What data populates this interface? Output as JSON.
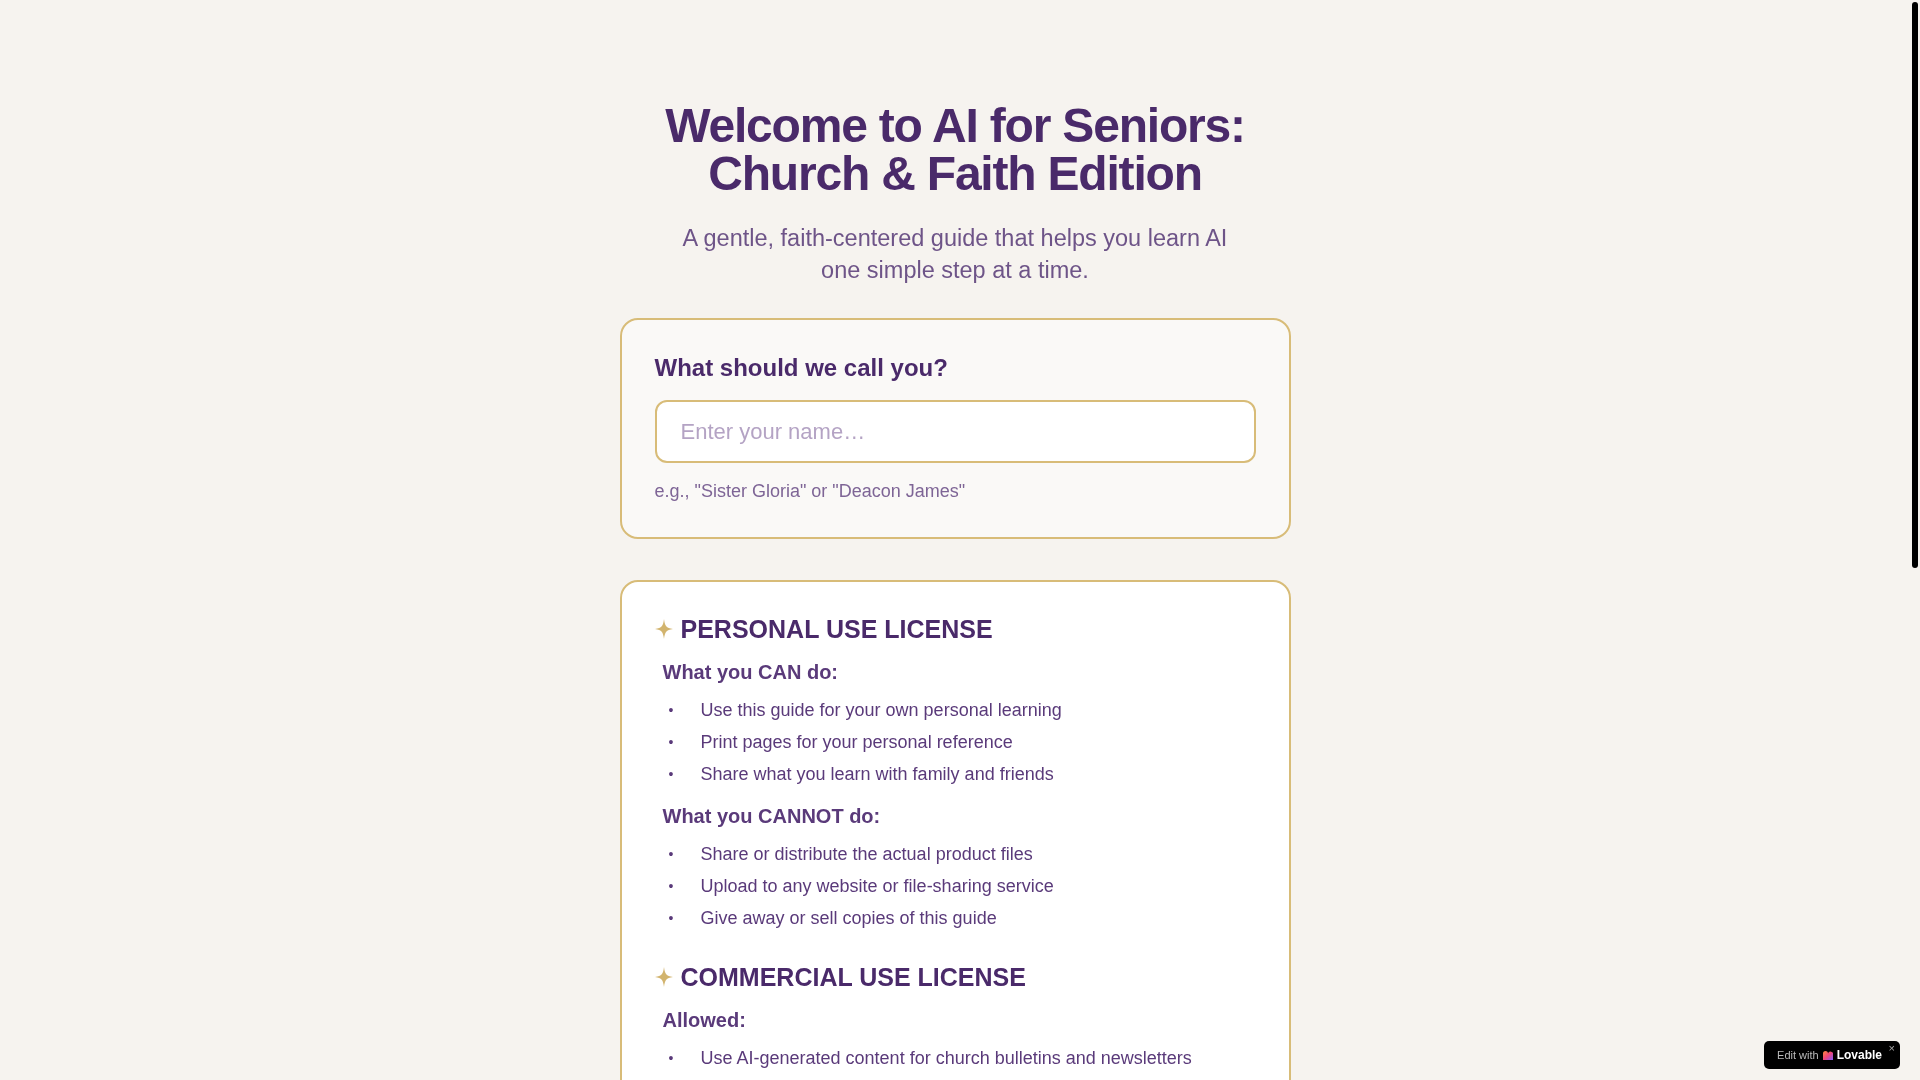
{
  "header": {
    "title_lines": [
      "Welcome to AI for Seniors:",
      "Church & Faith Edition"
    ],
    "subtitle_lines": [
      "A gentle, faith-centered guide that helps you learn AI",
      "one simple step at a time."
    ]
  },
  "name_card": {
    "heading": "What should we call you?",
    "placeholder": "Enter your name…",
    "hint": "e.g., \"Sister Gloria\" or \"Deacon James\""
  },
  "license_sections": [
    {
      "title": "PERSONAL USE LICENSE",
      "groups": [
        {
          "heading": "What you CAN do:",
          "items": [
            {
              "marker": "•",
              "text": "Use this guide for your own personal learning"
            },
            {
              "marker": "•",
              "text": "Print pages for your personal reference"
            },
            {
              "marker": "•",
              "text": "Share what you learn with family and friends"
            }
          ]
        },
        {
          "heading": "What you CANNOT do:",
          "items": [
            {
              "marker": "•",
              "text": "Share or distribute the actual product files"
            },
            {
              "marker": "•",
              "text": "Upload to any website or file-sharing service"
            },
            {
              "marker": "•",
              "text": "Give away or sell copies of this guide"
            }
          ]
        }
      ]
    },
    {
      "title": "COMMERCIAL USE LICENSE",
      "groups": [
        {
          "heading": "Allowed:",
          "items": [
            {
              "marker": "•",
              "text": "Use AI-generated content for church bulletins and newsletters"
            }
          ]
        }
      ]
    }
  ],
  "badge": {
    "prefix": "Edit with",
    "brand": "Lovable",
    "close": "×"
  }
}
